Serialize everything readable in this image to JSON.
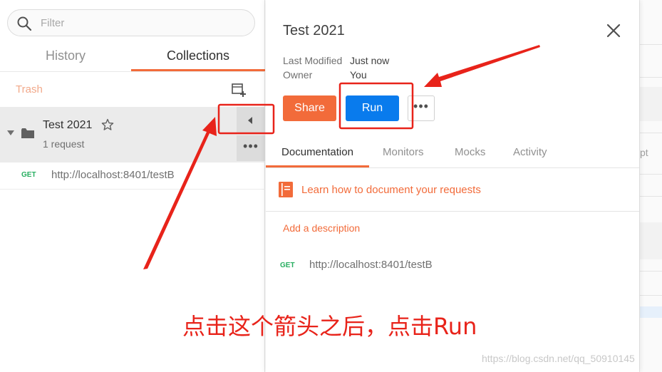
{
  "sidebar": {
    "search_placeholder": "Filter",
    "tabs": {
      "history": "History",
      "collections": "Collections"
    },
    "trash_label": "Trash",
    "collection": {
      "name": "Test 2021",
      "count": "1 request"
    },
    "request": {
      "method": "GET",
      "url": "http://localhost:8401/testB"
    }
  },
  "panel": {
    "title": "Test 2021",
    "meta": {
      "last_modified_label": "Last Modified",
      "last_modified_value": "Just now",
      "owner_label": "Owner",
      "owner_value": "You"
    },
    "buttons": {
      "share": "Share",
      "run": "Run",
      "more": "•••"
    },
    "tabs": {
      "documentation": "Documentation",
      "monitors": "Monitors",
      "mocks": "Mocks",
      "activity": "Activity"
    },
    "learn_link": "Learn how to document your requests",
    "add_description": "Add a description",
    "request": {
      "method": "GET",
      "url": "http://localhost:8401/testB"
    }
  },
  "background": {
    "partial_tab": "pt"
  },
  "annotation": {
    "caption": "点击这个箭头之后，点击Run",
    "watermark": "https://blog.csdn.net/qq_50910145",
    "color": "#e8231a"
  },
  "colors": {
    "accent": "#f26b3a",
    "primary": "#097bed",
    "get_method": "#27ae60"
  }
}
